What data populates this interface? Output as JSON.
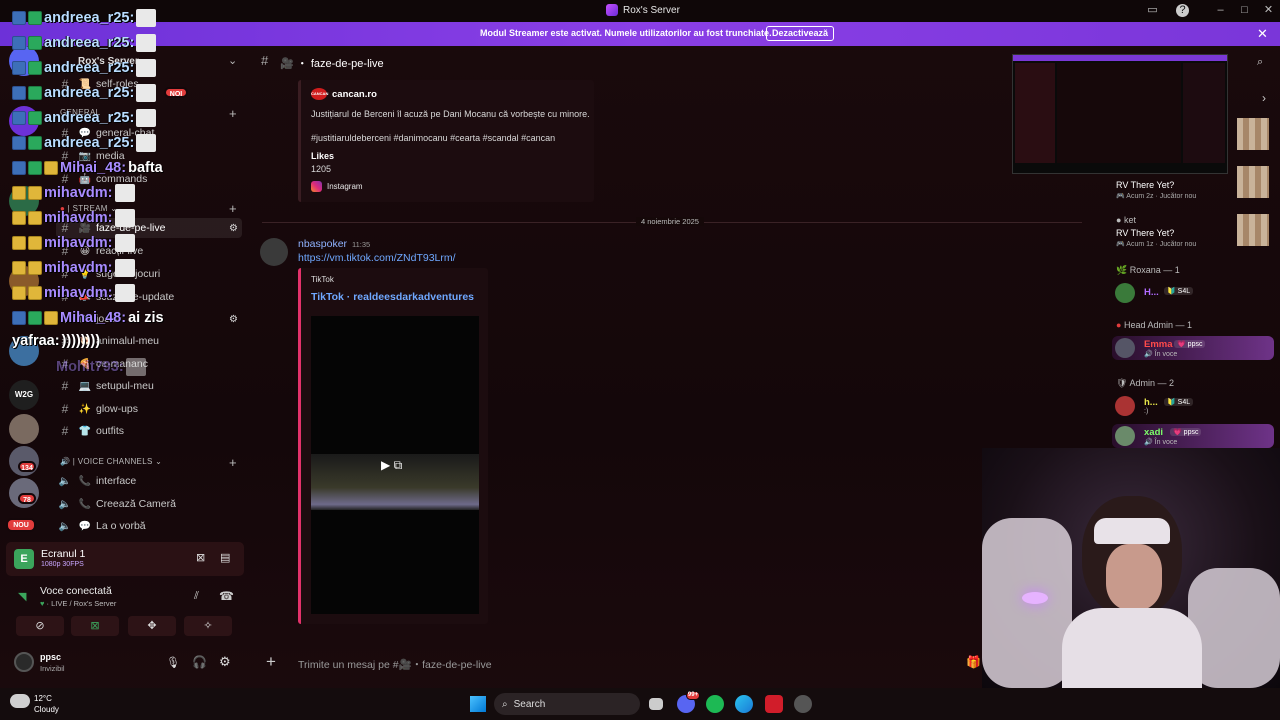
{
  "window": {
    "title": "Rox's Server"
  },
  "banner": {
    "message": "Modul Streamer este activat. Numele utilizatorilor au fost trunchiate.",
    "button": "Dezactivează"
  },
  "rail": {
    "badges": [
      "134",
      "78",
      "NOU",
      "NOI"
    ]
  },
  "sidebar": {
    "server_name": "Rox's Server",
    "categories": [
      "GENERAL",
      "| STREAM",
      "| VOICE CHANNELS"
    ],
    "channels": [
      {
        "emoji": "📜",
        "name": "self-roles"
      },
      {
        "emoji": "💬",
        "name": "general-chat"
      },
      {
        "emoji": "📷",
        "name": "media"
      },
      {
        "emoji": "🤖",
        "name": "commands"
      },
      {
        "emoji": "🎥",
        "name": "faze-de-pe-live"
      },
      {
        "emoji": "😀",
        "name": "reacții-live"
      },
      {
        "emoji": "💡",
        "name": "sugestii-jocuri"
      },
      {
        "emoji": "📣",
        "name": "scuza-de-update"
      },
      {
        "emoji": "🎮",
        "name": "jocuri"
      },
      {
        "emoji": "🐶",
        "name": "animalul-meu"
      },
      {
        "emoji": "🍕",
        "name": "ce-mananc"
      },
      {
        "emoji": "💻",
        "name": "setupul-meu"
      },
      {
        "emoji": "✨",
        "name": "glow-ups"
      },
      {
        "emoji": "👕",
        "name": "outfits"
      }
    ],
    "voice_channels": [
      {
        "emoji": "📞",
        "name": "interface"
      },
      {
        "emoji": "📞",
        "name": "Creează Cameră"
      },
      {
        "emoji": "💬",
        "name": "La o vorbă"
      }
    ]
  },
  "overlay_chat": [
    {
      "name": "andreea_r25:",
      "text": "",
      "color": "blue"
    },
    {
      "name": "andreea_r25:",
      "text": "",
      "color": "blue"
    },
    {
      "name": "andreea_r25:",
      "text": "",
      "color": "blue"
    },
    {
      "name": "andreea_r25:",
      "text": "",
      "color": "blue"
    },
    {
      "name": "andreea_r25:",
      "text": "",
      "color": "blue"
    },
    {
      "name": "andreea_r25:",
      "text": "",
      "color": "blue"
    },
    {
      "name": "Mihai_48:",
      "text": "bafta",
      "color": "purple"
    },
    {
      "name": "mihavdm:",
      "text": "",
      "color": "purple"
    },
    {
      "name": "mihavdm:",
      "text": "",
      "color": "purple"
    },
    {
      "name": "mihavdm:",
      "text": "",
      "color": "purple"
    },
    {
      "name": "mihavdm:",
      "text": "",
      "color": "purple"
    },
    {
      "name": "mihavdm:",
      "text": "",
      "color": "purple"
    },
    {
      "name": "Mihai_48:",
      "text": "ai zis",
      "color": "purple"
    },
    {
      "name": "yafraa:",
      "text": "))))))))",
      "color": "white"
    },
    {
      "name": "Mohit793:",
      "text": "",
      "color": "purple"
    }
  ],
  "stream_panel": {
    "letter": "E",
    "title": "Ecranul 1",
    "quality": "1080p 30FPS"
  },
  "voice_panel": {
    "status": "Voce conectată",
    "channel": "LIVE / Rox's Server"
  },
  "user_panel": {
    "name": "ppsc",
    "status": "Invizibil"
  },
  "chat": {
    "channel_name": "faze-de-pe-live",
    "embed_article": {
      "provider": "cancan.ro",
      "description": "Justițiarul de Berceni îl acuză pe Dani Mocanu că vorbește cu minore.",
      "hashtags": "#justitiaruldeberceni #danimocanu #cearta #scandal #cancan",
      "likes_label": "Likes",
      "likes_value": "1205",
      "source": "Instagram"
    },
    "date_separator": "4 noiembrie 2025",
    "message": {
      "author": "nbaspoker",
      "time": "11:35",
      "link": "https://vm.tiktok.com/ZNdT93Lrm/",
      "embed_provider": "TikTok",
      "embed_title": "TikTok · realdeesdarkadventures"
    },
    "composer_placeholder": "Trimite un mesaj pe #🎥・faze-de-pe-live"
  },
  "members": {
    "activities": [
      {
        "name": "RV There Yet?",
        "sub": "Acum 2z · Jucător nou"
      },
      {
        "user": "ket",
        "name": "RV There Yet?",
        "sub": "Acum 1z · Jucător nou"
      }
    ],
    "groups": [
      {
        "label": "Roxana — 1",
        "members": [
          {
            "name": "H...",
            "tag": "S4L",
            "status": ""
          }
        ]
      },
      {
        "label": "Head Admin — 1",
        "members": [
          {
            "name": "Emma",
            "tag": "ppsc",
            "status": "În voce"
          }
        ]
      },
      {
        "label": "Admin — 2",
        "members": [
          {
            "name": "h...",
            "tag": "S4L",
            "status": ":)"
          },
          {
            "name": "xadi",
            "tag": "ppsc",
            "status": "În voce"
          }
        ]
      }
    ]
  },
  "taskbar": {
    "temp": "12°C",
    "weather": "Cloudy",
    "search": "Search",
    "discord_badge": "99+"
  },
  "colors": {
    "accent": "#7b38d6",
    "link": "#6fa8ff",
    "banner": "#8a3fe6"
  }
}
